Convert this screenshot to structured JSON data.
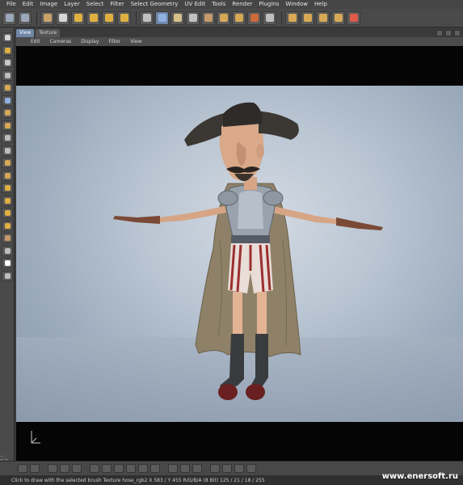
{
  "menubar": {
    "items": [
      "File",
      "Edit",
      "Image",
      "Layer",
      "Select",
      "Filter",
      "Select Geometry",
      "UV Edit",
      "Tools",
      "Render",
      "Plugins",
      "Window",
      "Help"
    ]
  },
  "toolbar": {
    "buttons": [
      "undo-icon",
      "redo-icon",
      "camera-icon",
      "select-arrow-icon",
      "move-icon",
      "scale-icon",
      "rotate-icon",
      "transform-icon",
      "lasso-icon",
      "paint-brush-icon",
      "eraser-icon",
      "pen-icon",
      "clone-icon",
      "projection-icon",
      "fill-icon",
      "uv-icon",
      "checker-icon",
      "render-icon",
      "window-icon",
      "grid-icon",
      "layout-icon",
      "record-icon"
    ],
    "selected_index": 9
  },
  "left_tools": {
    "icons": [
      "pointer-icon",
      "move-icon",
      "select-rect-icon",
      "lasso-icon",
      "magic-wand-icon",
      "paint-brush-icon",
      "airbrush-icon",
      "smudge-icon",
      "blur-icon",
      "sharpen-icon",
      "dodge-icon",
      "burn-icon",
      "clone-stamp-icon",
      "fill-bucket-icon",
      "text-icon",
      "star-icon",
      "eyedropper-icon",
      "zoom-icon",
      "color-swatch-icon",
      "reset-colors-icon"
    ],
    "vertical_label": "MARI 2.6v1 | FOUNDRY"
  },
  "viewport": {
    "tabs": [
      "View",
      "Texture"
    ],
    "active_tab": "View",
    "menu": [
      "Edit",
      "Cameras",
      "Display",
      "Filter",
      "View"
    ]
  },
  "status": {
    "text": "Click to draw with the selected brush  Texture hose_rgb2  X 583 / Y 455 R/G/B/A (8 Bit) 125 / 21 / 18 / 255"
  },
  "watermark": "www.enersoft.ru",
  "colors": {
    "accent": "#6f87a8",
    "panel": "#4a4a4a",
    "menubar": "#454545"
  }
}
